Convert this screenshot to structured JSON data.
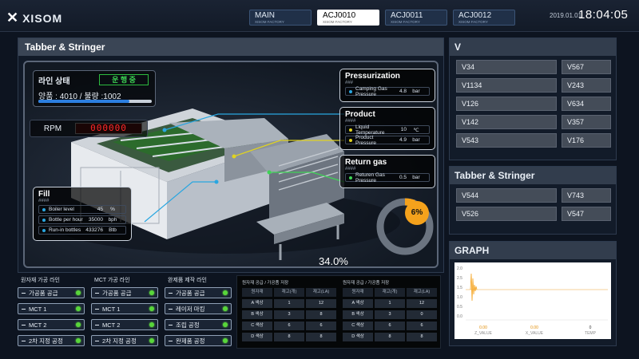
{
  "header": {
    "logo_text": "XISOM",
    "tabs": [
      {
        "label": "MAIN",
        "sub": "XISOM FACTORY",
        "active": false
      },
      {
        "label": "ACJ0010",
        "sub": "XISOM FACTORY",
        "active": true
      },
      {
        "label": "ACJ0011",
        "sub": "XISOM FACTORY",
        "active": false
      },
      {
        "label": "ACJ0012",
        "sub": "XISOM FACTORY",
        "active": false
      }
    ],
    "date": "2019.01.01",
    "time": "18:04:05"
  },
  "main": {
    "title": "Tabber & Stringer",
    "line_status": {
      "label": "라인 상태",
      "badge": "운 행 중",
      "counts": "양품 : 4010 / 불량 :1002",
      "progress": 0.8
    },
    "rpm": {
      "label": "RPM",
      "value": "000000"
    },
    "pressurization": {
      "title": "Pressurization",
      "sub": "###",
      "rows": [
        {
          "name": "Camping Gas Pressure",
          "value": "4.8",
          "unit": "bar"
        }
      ]
    },
    "product": {
      "title": "Product",
      "sub": "####",
      "rows": [
        {
          "name": "Liquid Temperature",
          "value": "10",
          "unit": "℃"
        },
        {
          "name": "Product Pressure",
          "value": "4.9",
          "unit": "bar"
        }
      ]
    },
    "return_gas": {
      "title": "Return gas",
      "sub": "####",
      "rows": [
        {
          "name": "Returen Gas Pressure",
          "value": "0.5",
          "unit": "bar"
        }
      ]
    },
    "fill": {
      "title": "Fill",
      "sub": "####",
      "rows": [
        {
          "name": "Boiler level",
          "value": "45",
          "unit": "%"
        },
        {
          "name": "Bottle per hour",
          "value": "35000",
          "unit": "bph"
        },
        {
          "name": "Run-in bottles",
          "value": "433276",
          "unit": "Btb"
        }
      ]
    },
    "donut_value": "6%",
    "donut_fraction": 0.06,
    "percent_label": "34.0%",
    "percent_fraction": 0.34
  },
  "v_panel": {
    "title": "V",
    "cells": [
      "V34",
      "V567",
      "V1134",
      "V243",
      "V126",
      "V634",
      "V142",
      "V357",
      "V543",
      "V176"
    ]
  },
  "tabber_panel": {
    "title": "Tabber & Stringer",
    "cells": [
      "V544",
      "V743",
      "V526",
      "V547"
    ]
  },
  "graph_panel": {
    "title": "GRAPH",
    "yticks": [
      "2.0",
      "2.5",
      "1.5",
      "1.0",
      "0.5",
      "0.0"
    ],
    "footer": [
      {
        "value": "0.00",
        "label": "Z_VALUE"
      },
      {
        "value": "0.00",
        "label": "X_VALUE"
      },
      {
        "value": "0",
        "label": "TEMP"
      }
    ]
  },
  "bottom_lists": [
    {
      "title": "원자재 가공 라인",
      "items": [
        "가공품 공급",
        "MCT 1",
        "MCT 2",
        "2차 지정 공정"
      ]
    },
    {
      "title": "MCT 가공 라인",
      "items": [
        "가공품 공급",
        "MCT 1",
        "MCT 2",
        "2차 지정 공정"
      ]
    },
    {
      "title": "완제품 제작 라인",
      "items": [
        "가공품 공급",
        "레이저 마킹",
        "조립 공정",
        "완제품 공정"
      ]
    }
  ],
  "tables": [
    {
      "title": "원자재 공급 / 가공품 저장",
      "headers": [
        "원자재",
        "재고(개)",
        "재고(LA)"
      ],
      "rows": [
        [
          "A 색상",
          "1",
          "12"
        ],
        [
          "B 색상",
          "3",
          "8"
        ],
        [
          "C 색상",
          "6",
          "6"
        ],
        [
          "D 색상",
          "8",
          "8"
        ]
      ]
    },
    {
      "title": "원자재 공급 / 가공품 저장",
      "headers": [
        "원자재",
        "재고(개)",
        "재고(LA)"
      ],
      "rows": [
        [
          "A 색상",
          "1",
          "12"
        ],
        [
          "B 색상",
          "3",
          "0"
        ],
        [
          "C 색상",
          "6",
          "6"
        ],
        [
          "D 색상",
          "8",
          "8"
        ]
      ]
    }
  ],
  "colors": {
    "accent": "#f5a21c",
    "status_green": "#3ed455",
    "rpm_red": "#ff2a2a"
  }
}
